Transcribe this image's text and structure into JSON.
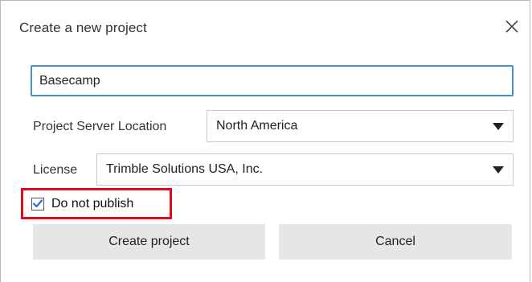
{
  "dialog": {
    "title": "Create a new project",
    "close_icon": "close-icon"
  },
  "form": {
    "project_name": {
      "value": "Basecamp",
      "placeholder": ""
    },
    "server_location": {
      "label": "Project Server Location",
      "selected": "North America"
    },
    "license": {
      "label": "License",
      "selected": "Trimble Solutions USA, Inc."
    },
    "do_not_publish": {
      "label": "Do not publish",
      "checked": true
    }
  },
  "buttons": {
    "create_label": "Create project",
    "cancel_label": "Cancel"
  },
  "colors": {
    "accent": "#4a90c8",
    "highlight": "#e10c17",
    "checkmark": "#1f6fd1",
    "button_bg": "#e6e6e6"
  }
}
